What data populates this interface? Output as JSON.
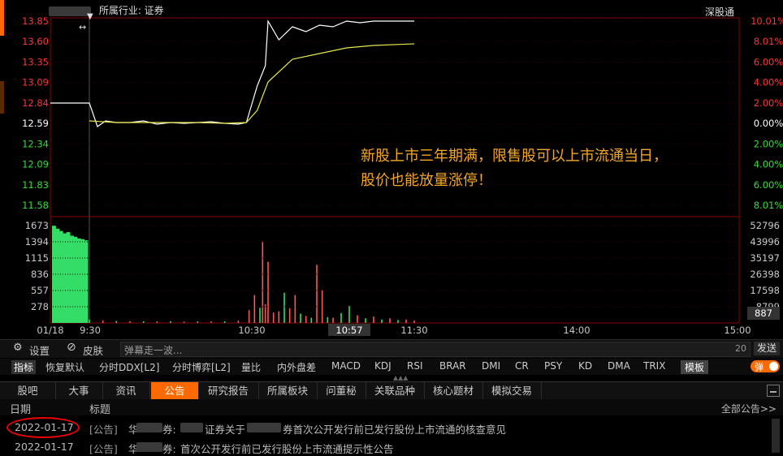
{
  "header": {
    "industry_label": "所属行业: 证券",
    "exchange_link": "深股通"
  },
  "chart_data": [
    {
      "type": "line",
      "title": "",
      "y_left_ticks": [
        "13.85",
        "13.60",
        "13.35",
        "13.09",
        "12.84",
        "12.59",
        "12.34",
        "12.09",
        "11.83",
        "11.58"
      ],
      "y_right_ticks": [
        "10.01%",
        "8.01%",
        "6.00%",
        "4.00%",
        "2.00%",
        "0.00%",
        "2.00%",
        "4.00%",
        "6.00%",
        "8.01%"
      ],
      "y_right_colors": [
        "#ff3333",
        "#ff3333",
        "#ff3333",
        "#ff3333",
        "#ff3333",
        "#ffffff",
        "#33dd33",
        "#33dd33",
        "#33dd33",
        "#33dd33"
      ],
      "ylim": [
        11.58,
        13.85
      ],
      "x_ticks": [
        "01/18",
        "9:30",
        "10:30",
        "10:57",
        "11:30",
        "14:00",
        "15:00"
      ],
      "series": [
        {
          "kind": "price",
          "color": "#ffffff",
          "x": [
            "09:15",
            "09:20",
            "09:25",
            "09:30",
            "09:33",
            "09:36",
            "09:40",
            "09:45",
            "09:50",
            "09:55",
            "10:00",
            "10:05",
            "10:10",
            "10:15",
            "10:20",
            "10:25",
            "10:28",
            "10:32",
            "10:35",
            "10:36",
            "10:40",
            "10:45",
            "10:50",
            "10:55",
            "11:00",
            "11:05",
            "11:10",
            "11:15",
            "11:20",
            "11:25",
            "11:30"
          ],
          "y": [
            12.84,
            12.84,
            12.84,
            12.84,
            12.55,
            12.62,
            12.6,
            12.6,
            12.62,
            12.58,
            12.6,
            12.59,
            12.6,
            12.61,
            12.59,
            12.58,
            12.6,
            13.05,
            13.3,
            13.85,
            13.62,
            13.78,
            13.72,
            13.8,
            13.78,
            13.85,
            13.83,
            13.85,
            13.85,
            13.85,
            13.85
          ]
        },
        {
          "kind": "avg",
          "color": "#e6e64d",
          "x": [
            "09:30",
            "09:40",
            "09:50",
            "10:00",
            "10:10",
            "10:20",
            "10:28",
            "10:32",
            "10:36",
            "10:45",
            "10:55",
            "11:05",
            "11:15",
            "11:30"
          ],
          "y": [
            12.62,
            12.6,
            12.6,
            12.6,
            12.6,
            12.59,
            12.6,
            12.75,
            13.1,
            13.38,
            13.45,
            13.52,
            13.55,
            13.57
          ]
        }
      ],
      "annotation": [
        "新股上市三年期满，限售股可以上市流通当日，",
        "股价也能放量涨停！"
      ]
    },
    {
      "type": "bar",
      "title": "",
      "y_left_ticks": [
        "1673",
        "1394",
        "1115",
        "836",
        "557",
        "278"
      ],
      "y_right_ticks": [
        "52796",
        "43996",
        "35197",
        "26398",
        "17598",
        "8799"
      ],
      "current_value": "887",
      "auction_buy": [
        1673,
        1620,
        1580,
        1540,
        1560,
        1500,
        1480,
        1450,
        1440,
        1420
      ],
      "auction_sell": [
        278,
        330,
        380,
        450,
        520,
        600,
        700,
        820,
        900,
        1000
      ],
      "volume": [
        {
          "t": "09:30",
          "v": 60,
          "c": "g"
        },
        {
          "t": "09:35",
          "v": 40,
          "c": "r"
        },
        {
          "t": "09:40",
          "v": 35,
          "c": "g"
        },
        {
          "t": "09:45",
          "v": 30,
          "c": "r"
        },
        {
          "t": "09:50",
          "v": 28,
          "c": "g"
        },
        {
          "t": "09:55",
          "v": 25,
          "c": "r"
        },
        {
          "t": "10:00",
          "v": 30,
          "c": "g"
        },
        {
          "t": "10:05",
          "v": 22,
          "c": "r"
        },
        {
          "t": "10:10",
          "v": 26,
          "c": "g"
        },
        {
          "t": "10:15",
          "v": 24,
          "c": "r"
        },
        {
          "t": "10:20",
          "v": 28,
          "c": "g"
        },
        {
          "t": "10:25",
          "v": 40,
          "c": "r"
        },
        {
          "t": "10:29",
          "v": 220,
          "c": "r"
        },
        {
          "t": "10:31",
          "v": 480,
          "c": "r"
        },
        {
          "t": "10:33",
          "v": 260,
          "c": "g"
        },
        {
          "t": "10:34",
          "v": 1400,
          "c": "r"
        },
        {
          "t": "10:35",
          "v": 320,
          "c": "r"
        },
        {
          "t": "10:36",
          "v": 1050,
          "c": "r"
        },
        {
          "t": "10:38",
          "v": 180,
          "c": "r"
        },
        {
          "t": "10:40",
          "v": 200,
          "c": "r"
        },
        {
          "t": "10:42",
          "v": 520,
          "c": "g"
        },
        {
          "t": "10:44",
          "v": 250,
          "c": "r"
        },
        {
          "t": "10:46",
          "v": 480,
          "c": "r"
        },
        {
          "t": "10:48",
          "v": 160,
          "c": "g"
        },
        {
          "t": "10:50",
          "v": 120,
          "c": "r"
        },
        {
          "t": "10:52",
          "v": 90,
          "c": "g"
        },
        {
          "t": "10:54",
          "v": 1000,
          "c": "r"
        },
        {
          "t": "10:56",
          "v": 560,
          "c": "r"
        },
        {
          "t": "10:58",
          "v": 100,
          "c": "g"
        },
        {
          "t": "11:00",
          "v": 90,
          "c": "r"
        },
        {
          "t": "11:03",
          "v": 170,
          "c": "g"
        },
        {
          "t": "11:06",
          "v": 290,
          "c": "g"
        },
        {
          "t": "11:09",
          "v": 130,
          "c": "r"
        },
        {
          "t": "11:12",
          "v": 80,
          "c": "g"
        },
        {
          "t": "11:15",
          "v": 110,
          "c": "r"
        },
        {
          "t": "11:18",
          "v": 60,
          "c": "g"
        },
        {
          "t": "11:21",
          "v": 80,
          "c": "r"
        },
        {
          "t": "11:24",
          "v": 50,
          "c": "g"
        },
        {
          "t": "11:27",
          "v": 60,
          "c": "r"
        },
        {
          "t": "11:30",
          "v": 40,
          "c": "r"
        }
      ]
    }
  ],
  "toolbar": {
    "settings": "设置",
    "skin": "皮肤",
    "danmaku_placeholder": "弹幕走一波...",
    "counter": "20",
    "send": "发送"
  },
  "indicators": [
    "指标",
    "恢复默认",
    "分时DDX[L2]",
    "分时博弈[L2]",
    "量比",
    "内外盘差",
    "MACD",
    "KDJ",
    "RSI",
    "BRAR",
    "DMI",
    "CR",
    "PSY",
    "KD",
    "DMA",
    "TRIX",
    "模板"
  ],
  "danmaku_toggle": "弹",
  "tabs": [
    "股吧",
    "大事",
    "资讯",
    "公告",
    "研究报告",
    "所属板块",
    "问董秘",
    "关联品种",
    "核心题材",
    "模拟交易"
  ],
  "active_tab": "公告",
  "table": {
    "col_date": "日期",
    "col_title": "标题",
    "all_link": "全部公告>>",
    "rows": [
      {
        "date": "2022-01-17",
        "prefix": "[公告]",
        "title_a": "华",
        "title_b": "券:",
        "title_c": "证券关于",
        "title_d": "券首次公开发行前已发行股份上市流通的核查意见"
      },
      {
        "date": "2022-01-17",
        "prefix": "[公告]",
        "title_a": "华",
        "title_b": "券:",
        "title_c": "首次公开发行前已发行股份上市流通提示性公告",
        "title_d": ""
      }
    ]
  }
}
